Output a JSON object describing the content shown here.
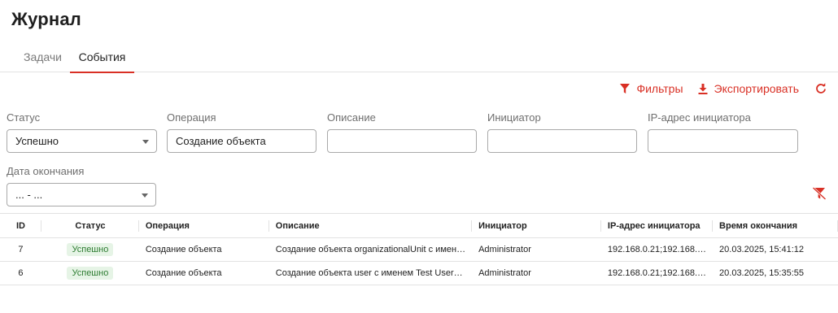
{
  "page": {
    "title": "Журнал"
  },
  "tabs": [
    {
      "label": "Задачи",
      "active": false
    },
    {
      "label": "События",
      "active": true
    }
  ],
  "toolbar": {
    "filters_label": "Фильтры",
    "export_label": "Экспортировать",
    "refresh_icon": "refresh-icon",
    "accent_color": "#d93025"
  },
  "filters": {
    "status": {
      "label": "Статус",
      "value": "Успешно"
    },
    "operation": {
      "label": "Операция",
      "value": "Создание объекта"
    },
    "description": {
      "label": "Описание",
      "value": ""
    },
    "initiator": {
      "label": "Инициатор",
      "value": ""
    },
    "ip": {
      "label": "IP-адрес инициатора",
      "value": ""
    },
    "end_date": {
      "label": "Дата окончания",
      "value": "... - ..."
    }
  },
  "table": {
    "columns": [
      "ID",
      "Статус",
      "Операция",
      "Описание",
      "Инициатор",
      "IP-адрес инициатора",
      "Время окончания"
    ],
    "rows": [
      {
        "id": "7",
        "status": "Успешно",
        "operation": "Создание объекта",
        "description": "Создание объекта organizationalUnit с имен…",
        "initiator": "Administrator",
        "ip": "192.168.0.21;192.168.…",
        "end_time": "20.03.2025, 15:41:12"
      },
      {
        "id": "6",
        "status": "Успешно",
        "operation": "Создание объекта",
        "description": "Создание объекта user с именем Test User…",
        "initiator": "Administrator",
        "ip": "192.168.0.21;192.168.…",
        "end_time": "20.03.2025, 15:35:55"
      }
    ]
  }
}
